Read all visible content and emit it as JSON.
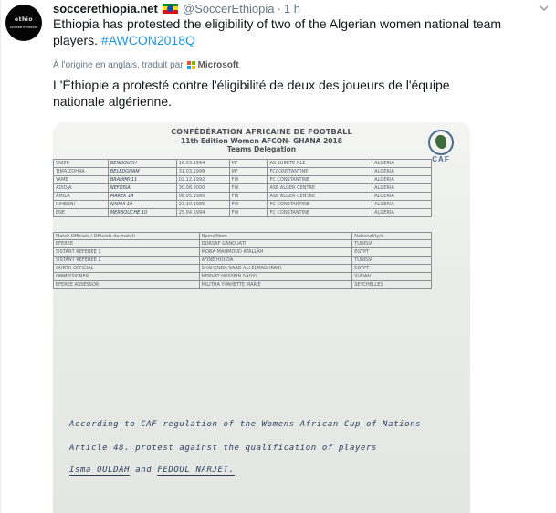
{
  "tweet": {
    "avatar": {
      "line1": "ethio",
      "line2": "SOCCER ETHIOPIA"
    },
    "display_name": "soccerethiopia.net",
    "handle": "@SoccerEthiopia",
    "separator": "·",
    "time": "1 h",
    "text": "Ethiopia has protested the eligibility of two of the Algerian women national team players. ",
    "hashtag": "#AWCON2018Q",
    "translation_note": "À l'origine en anglais, traduit par",
    "translator": "Microsoft",
    "translated_text": "L'Éthiopie a protesté contre l'éligibilité de deux des joueurs de l'équipe nationale algérienne."
  },
  "colors": {
    "link": "#1b95e0",
    "muted": "#657786",
    "ms_red": "#f25022",
    "ms_green": "#7fba00",
    "ms_blue": "#00a4ef",
    "ms_yellow": "#ffb900"
  },
  "icons": {
    "caret": "chevron-down-icon",
    "flag": "ethiopia-flag-icon",
    "translator": "microsoft-logo-icon"
  },
  "document": {
    "title1": "CONFÉDÉRATION AFRICAINE DE FOOTBALL",
    "title2": "11th Edition Women AFCON- GHANA 2018",
    "title3": "Teams Delegation",
    "logo_text": "CAF",
    "players": [
      {
        "first": "SNIER",
        "last": "BENDOUCH",
        "dob": "16.03.1994",
        "pos": "MF",
        "club": "AS SURETE NLE",
        "country": "ALGERIA"
      },
      {
        "first": "TIMA ZOHRA",
        "last": "BELEDGHAM",
        "dob": "31.03.1998",
        "pos": "MF",
        "club": "FCCONSTANTINE",
        "country": "ALGERIA"
      },
      {
        "first": "YAME",
        "last": "BRAHIMI 11",
        "dob": "02.12.1992",
        "pos": "FW",
        "club": "FC CONSTANTINE",
        "country": "ALGERIA"
      },
      {
        "first": "ADIDJA",
        "last": "NEFOISA",
        "dob": "30.08.2000",
        "pos": "FW",
        "club": "ASE ALGER CENTRE",
        "country": "ALGERIA"
      },
      {
        "first": "AMILA",
        "last": "MAREK 14",
        "dob": "08.05.1980",
        "pos": "FW",
        "club": "ASE ALGER CENTRE",
        "country": "ALGERIA"
      },
      {
        "first": "IUHENNI",
        "last": "NAIMA 19",
        "dob": "23.10.1985",
        "pos": "FW",
        "club": "FC CONSTANTINE",
        "country": "ALGERIA"
      },
      {
        "first": "ENE",
        "last": "MERBOUCHE 10",
        "dob": "25.04.1994",
        "pos": "FW",
        "club": "FC CONSTANTINE",
        "country": "ALGERIA"
      }
    ],
    "officials_header": {
      "role": "Match Officials / Officiels du match",
      "name": "Name/Nom",
      "nat": "Nationality/é"
    },
    "officials": [
      {
        "role": "EFEREE",
        "name": "DORSAF GANOUATI",
        "nat": "TUNISIA"
      },
      {
        "role": "SISTANT REFEREE 1",
        "name": "MONA MAHMOUD ATALLAH",
        "nat": "EGYPT"
      },
      {
        "role": "SISTANT REFEREE 2",
        "name": "AFINE HOUDA",
        "nat": "TUNISIA"
      },
      {
        "role": "OURTH OFFICIAL",
        "name": "SHAHENDA SAAD ALI ELMAGHRABI",
        "nat": "EGYPT"
      },
      {
        "role": "OMMISSIONER",
        "name": "MERVAT HUSSEIN SADIG",
        "nat": "SUDAN"
      },
      {
        "role": "EFEREE ASSESSOR",
        "name": "MILITHA YVAHETTE MARIE",
        "nat": "SEYCHELLES"
      }
    ],
    "note_line1": "According to CAF regulation of the Womens African Cup of Nations",
    "note_line2": "Article 48. protest against the qualification of players",
    "note_line3a": "Isma OULDAH",
    "note_line3b": "and",
    "note_line3c": "FEDOUL NARJET."
  }
}
